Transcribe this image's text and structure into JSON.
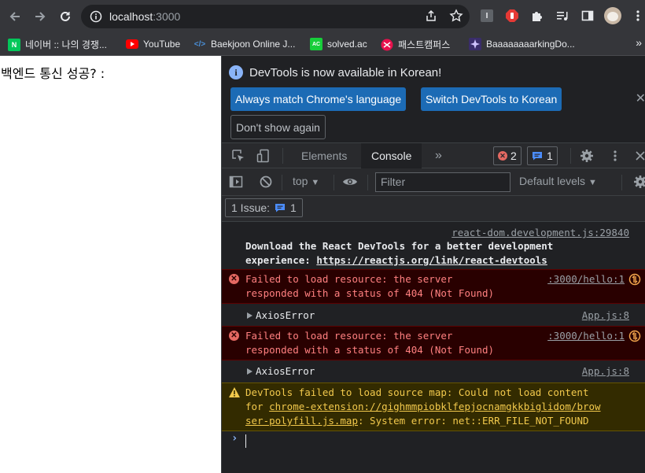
{
  "browser": {
    "url_host": "localhost",
    "url_port": ":3000",
    "bookmarks": [
      {
        "label": "네이버 :: 나의 경쟁...",
        "icon": "naver-icon",
        "icon_text": "N",
        "color": "#03c75a"
      },
      {
        "label": "YouTube",
        "icon": "youtube-icon",
        "icon_text": "",
        "color": "#ff0000"
      },
      {
        "label": "Baekjoon Online J...",
        "icon": "baekjoon-icon",
        "icon_text": "</>",
        "color": "#0076c0"
      },
      {
        "label": "solved.ac",
        "icon": "solvedac-icon",
        "icon_text": "AC",
        "color": "#17ce3a"
      },
      {
        "label": "패스트캠퍼스",
        "icon": "fastcampus-icon",
        "icon_text": "",
        "color": "#e8114d"
      },
      {
        "label": "BaaaaaaaarkingDo...",
        "icon": "barkingdog-icon",
        "icon_text": "",
        "color": "#3a2d6b"
      }
    ],
    "bookmarks_more": "»"
  },
  "page": {
    "text": "백엔드 통신 성공? :"
  },
  "devtools": {
    "infobar": {
      "message": "DevTools is now available in Korean!",
      "btn_match": "Always match Chrome's language",
      "btn_switch": "Switch DevTools to Korean",
      "btn_dismiss": "Don't show again"
    },
    "tabs": {
      "elements": "Elements",
      "console": "Console",
      "more": "»",
      "error_count": "2",
      "issue_count": "1"
    },
    "filterbar": {
      "context": "top",
      "filter_placeholder": "Filter",
      "levels": "Default levels"
    },
    "issues": {
      "label": "1 Issue:",
      "count": "1"
    },
    "console": {
      "msg1": {
        "source": "react-dom.development.js:29840",
        "line1": "Download the React DevTools for a better development",
        "line2_prefix": "experience: ",
        "link": "https://reactjs.org/link/react-devtools"
      },
      "err1": {
        "line1": "Failed to load resource: the server",
        "line2": "responded with a status of 404 (Not Found)",
        "source": ":3000/hello:1"
      },
      "axios1": {
        "label": "AxiosError",
        "source": "App.js:8"
      },
      "err2": {
        "line1": "Failed to load resource: the server",
        "line2": "responded with a status of 404 (Not Found)",
        "source": ":3000/hello:1"
      },
      "axios2": {
        "label": "AxiosError",
        "source": "App.js:8"
      },
      "warn": {
        "line1": "DevTools failed to load source map: Could not load content",
        "line2_prefix": "for ",
        "line2_link": "chrome-extension://gighmmpiobklfepjocnamgkkbiglidom/brow",
        "line3_link": "ser-polyfill.js.map",
        "line3_suffix": ": System error: net::ERR_FILE_NOT_FOUND"
      },
      "prompt": "›"
    }
  },
  "colors": {
    "error_bg": "#290000",
    "error_text": "#ff8080",
    "warn_bg": "#332b00",
    "warn_text": "#f2c94c",
    "primary_button": "#1c6bb5"
  }
}
